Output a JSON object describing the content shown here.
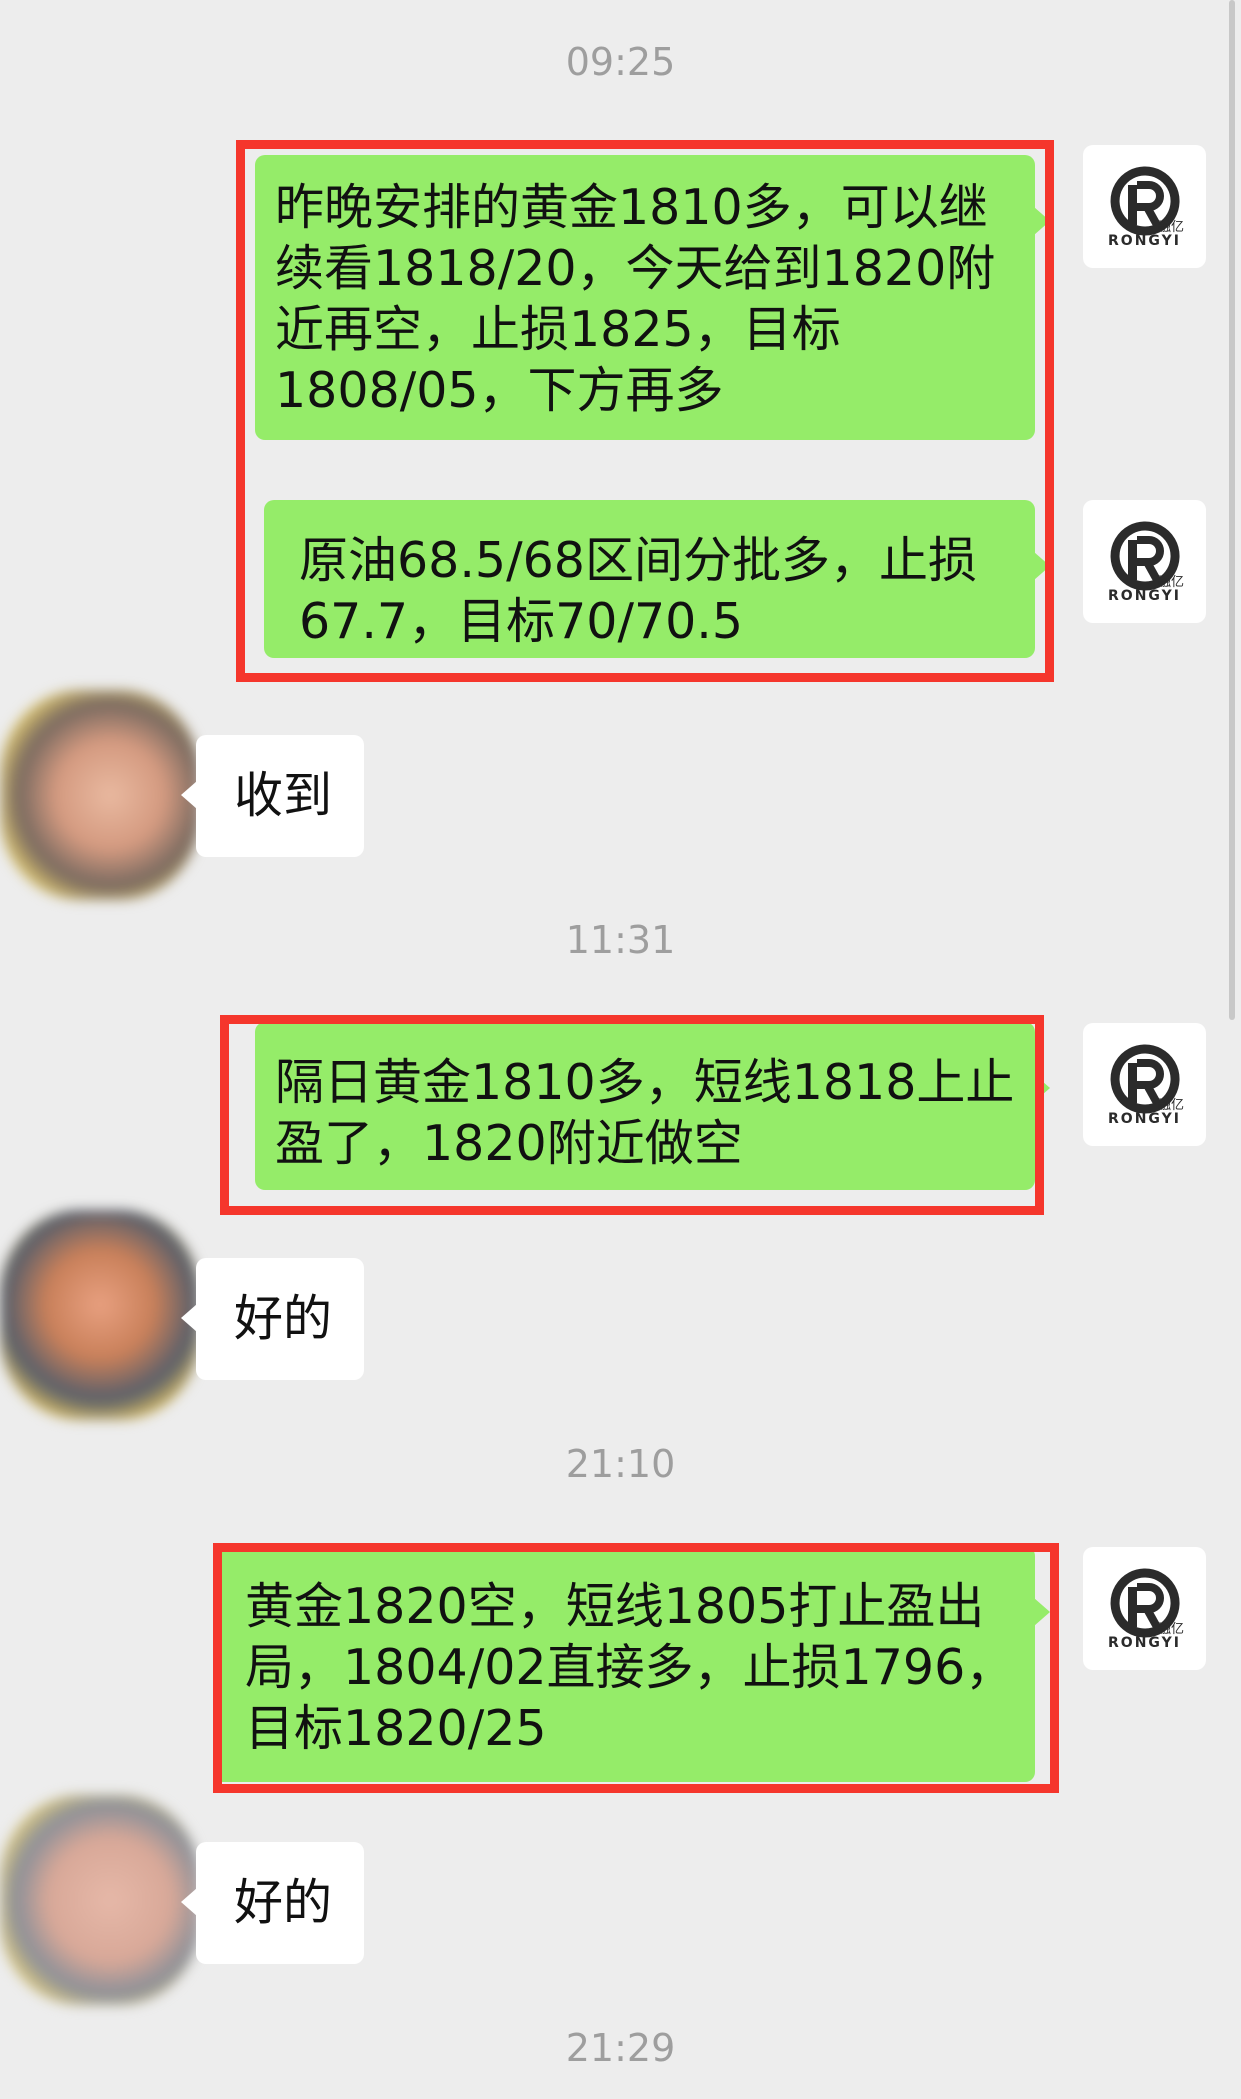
{
  "timestamps": [
    "09:25",
    "11:31",
    "21:10",
    "21:29"
  ],
  "messages": {
    "m1": "昨晚安排的黄金1810多，可以继续看1818/20，今天给到1820附近再空，止损1825，目标1808/05，下方再多",
    "m2": "原油68.5/68区间分批多，止损67.7，目标70/70.5",
    "r1": "收到",
    "m3": "隔日黄金1810多，短线1818上止盈了，1820附近做空",
    "r2": "好的",
    "m4": "黄金1820空，短线1805打止盈出局，1804/02直接多，止损1796，目标1820/25",
    "r3": "好的"
  },
  "logo": {
    "brand": "RONGYI",
    "sub": "融亿",
    "icon": "rongyi-logo-icon"
  },
  "colors": {
    "bubble_green": "#95ec69",
    "highlight_red": "#f5362c",
    "bg": "#ededed"
  }
}
